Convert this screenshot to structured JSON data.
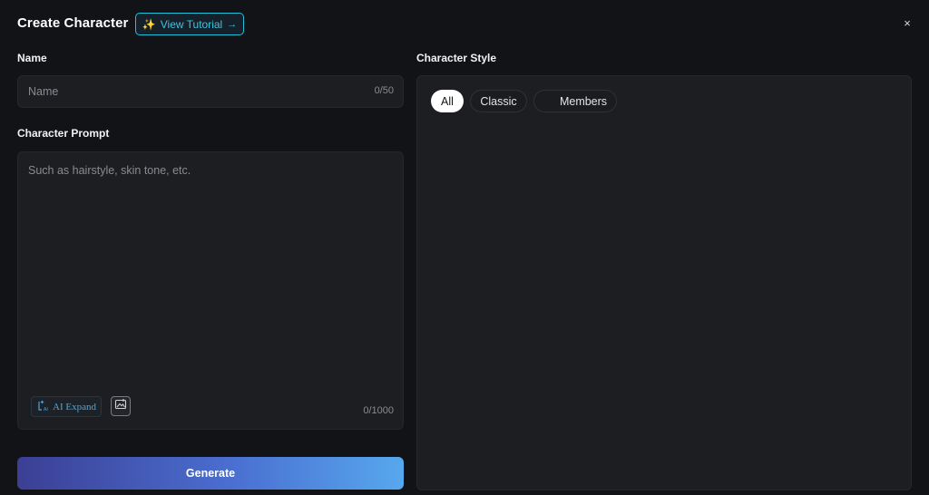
{
  "header": {
    "title": "Create Character",
    "tutorial_label": "View Tutorial",
    "tutorial_arrow": "→",
    "close_label": "×"
  },
  "name_section": {
    "label": "Name",
    "placeholder": "Name",
    "value": "",
    "counter": "0/50"
  },
  "prompt_section": {
    "label": "Character Prompt",
    "placeholder": "Such as hairstyle, skin tone, etc.",
    "value": "",
    "counter": "0/1000",
    "ai_expand_label": "AI Expand"
  },
  "generate_label": "Generate",
  "style_section": {
    "label": "Character Style",
    "filters": [
      "All",
      "Classic",
      "Members"
    ],
    "selected_filter": "All"
  },
  "icons": {
    "tutorial": "sparkle-icon",
    "close": "close-icon",
    "ai_expand": "ai-expand-icon",
    "image_upload": "image-upload-icon"
  },
  "colors": {
    "background": "#121316",
    "panel": "#1d1e22",
    "accent_cyan": "#1ec1d8",
    "generate_gradient_start": "#3b3f94",
    "generate_gradient_end": "#57a8ee"
  }
}
